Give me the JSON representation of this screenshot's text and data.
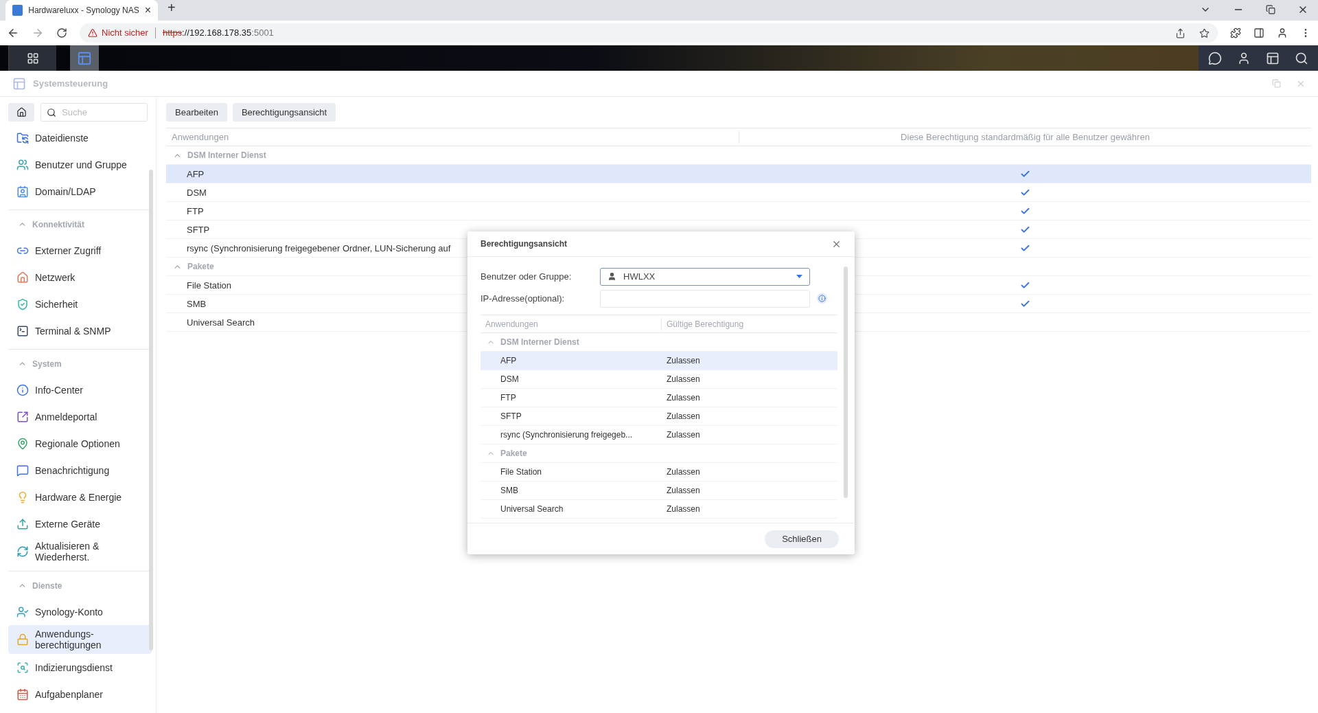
{
  "browser": {
    "tab": {
      "title": "Hardwareluxx - Synology NAS",
      "close": "×"
    },
    "new_tab": "+",
    "security": "Nicht sicher",
    "url": {
      "scheme": "https",
      "host": "://192.168.178.35",
      "port": ":5001"
    }
  },
  "window": {
    "title": "Systemsteuerung"
  },
  "sidebar": {
    "search": {
      "placeholder": "Suche"
    },
    "sections": [
      {
        "items": [
          {
            "label": "Dateidienste",
            "selected": false
          },
          {
            "label": "Benutzer und Gruppe",
            "selected": false
          },
          {
            "label": "Domain/LDAP",
            "selected": false
          }
        ]
      },
      {
        "title": "Konnektivität",
        "items": [
          {
            "label": "Externer Zugriff",
            "selected": false
          },
          {
            "label": "Netzwerk",
            "selected": false
          },
          {
            "label": "Sicherheit",
            "selected": false
          },
          {
            "label": "Terminal & SNMP",
            "selected": false
          }
        ]
      },
      {
        "title": "System",
        "items": [
          {
            "label": "Info-Center",
            "selected": false
          },
          {
            "label": "Anmeldeportal",
            "selected": false
          },
          {
            "label": "Regionale Optionen",
            "selected": false
          },
          {
            "label": "Benachrichtigung",
            "selected": false
          },
          {
            "label": "Hardware & Energie",
            "selected": false
          },
          {
            "label": "Externe Geräte",
            "selected": false
          },
          {
            "label": "Aktualisieren & Wiederherst.",
            "selected": false
          }
        ]
      },
      {
        "title": "Dienste",
        "items": [
          {
            "label": "Synology-Konto",
            "selected": false
          },
          {
            "label": "Anwendungs-berechtigungen",
            "selected": true
          },
          {
            "label": "Indizierungsdienst",
            "selected": false
          },
          {
            "label": "Aufgabenplaner",
            "selected": false
          }
        ]
      }
    ]
  },
  "toolbar": {
    "buttons": [
      "Bearbeiten",
      "Berechtigungsansicht"
    ]
  },
  "table": {
    "columns": [
      "Anwendungen",
      "Diese Berechtigung standardmäßig für alle Benutzer gewähren"
    ],
    "groups": [
      {
        "title": "DSM Interner Dienst",
        "expanded": true,
        "rows": [
          {
            "name": "AFP",
            "granted": true,
            "selected": true
          },
          {
            "name": "DSM",
            "granted": true,
            "selected": false
          },
          {
            "name": "FTP",
            "granted": true,
            "selected": false
          },
          {
            "name": "SFTP",
            "granted": true,
            "selected": false
          },
          {
            "name": "rsync (Synchronisierung freigegebener Ordner, LUN-Sicherung auf",
            "granted": true,
            "selected": false
          }
        ]
      },
      {
        "title": "Pakete",
        "expanded": true,
        "rows": [
          {
            "name": "File Station",
            "granted": true,
            "selected": false
          },
          {
            "name": "SMB",
            "granted": true,
            "selected": false
          },
          {
            "name": "Universal Search",
            "granted": false,
            "selected": false
          }
        ]
      }
    ]
  },
  "dialog": {
    "title": "Berechtigungsansicht",
    "user_label": "Benutzer oder Gruppe:",
    "user_value": "HWLXX",
    "ip_label": "IP-Adresse(optional):",
    "columns": [
      "Anwendungen",
      "Gültige Berechtigung"
    ],
    "groups": [
      {
        "title": "DSM Interner Dienst",
        "expanded": true,
        "rows": [
          {
            "name": "AFP",
            "permission": "Zulassen",
            "selected": true
          },
          {
            "name": "DSM",
            "permission": "Zulassen",
            "selected": false
          },
          {
            "name": "FTP",
            "permission": "Zulassen",
            "selected": false
          },
          {
            "name": "SFTP",
            "permission": "Zulassen",
            "selected": false
          },
          {
            "name": "rsync (Synchronisierung freigegeb...",
            "permission": "Zulassen",
            "selected": false
          }
        ]
      },
      {
        "title": "Pakete",
        "expanded": true,
        "rows": [
          {
            "name": "File Station",
            "permission": "Zulassen",
            "selected": false
          },
          {
            "name": "SMB",
            "permission": "Zulassen",
            "selected": false
          },
          {
            "name": "Universal Search",
            "permission": "Zulassen",
            "selected": false
          }
        ]
      }
    ],
    "close_button": "Schließen"
  }
}
